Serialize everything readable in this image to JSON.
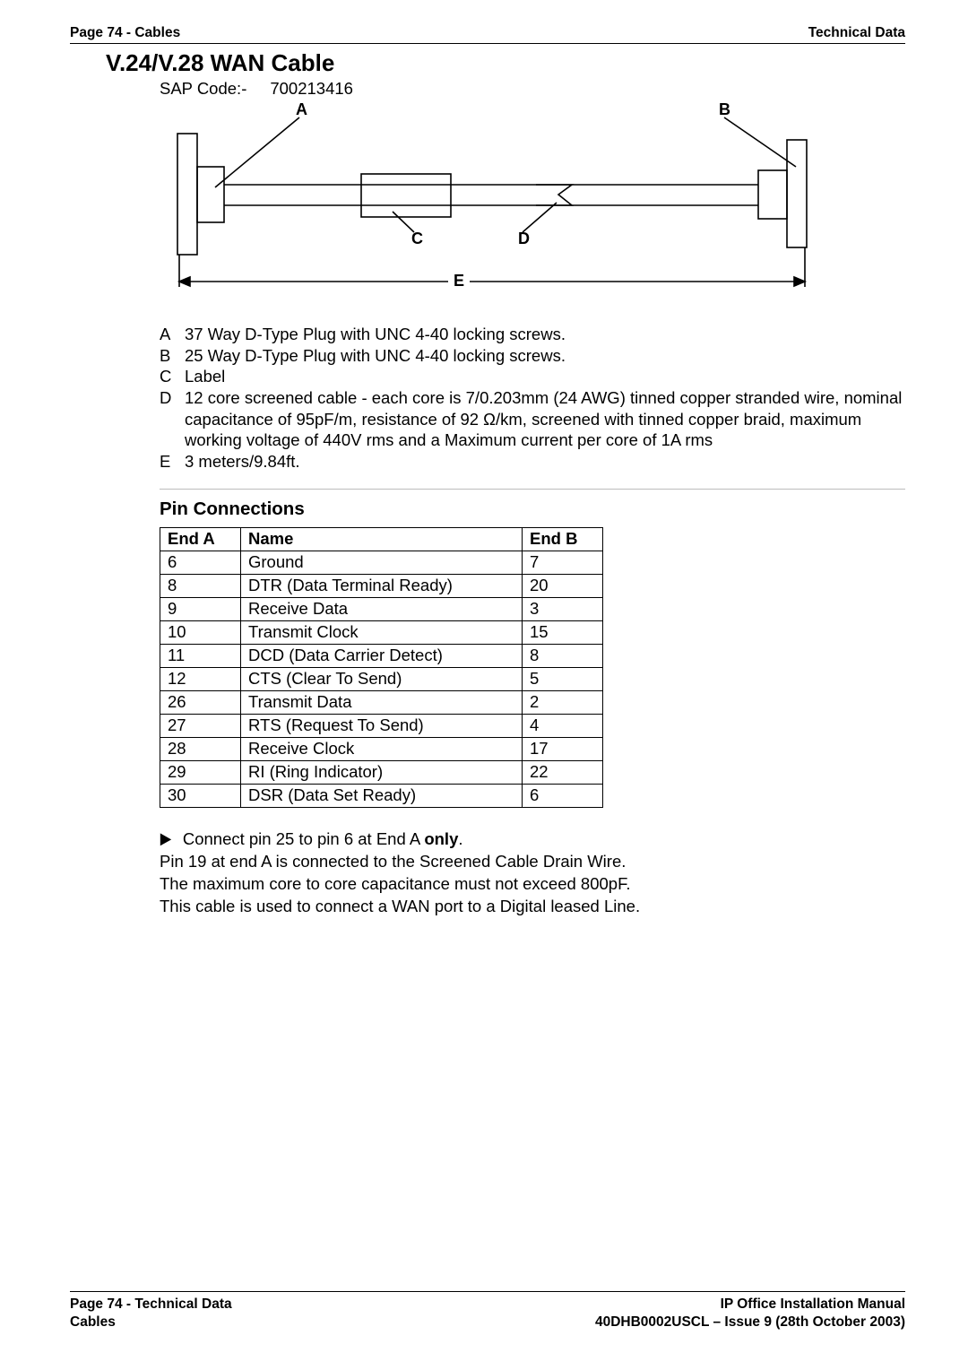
{
  "header": {
    "left": "Page 74 - Cables",
    "right": "Technical Data"
  },
  "title": "V.24/V.28 WAN Cable",
  "sap_label": "SAP Code:-",
  "sap_code": "700213416",
  "diagram": {
    "A": "A",
    "B": "B",
    "C": "C",
    "D": "D",
    "E": "E"
  },
  "definitions": [
    {
      "key": "A",
      "val": "37 Way D-Type Plug with UNC 4-40 locking screws."
    },
    {
      "key": "B",
      "val": "25 Way D-Type Plug with UNC 4-40 locking screws."
    },
    {
      "key": "C",
      "val": "Label"
    },
    {
      "key": "D",
      "val": "12 core screened cable - each core is 7/0.203mm (24 AWG) tinned copper stranded wire, nominal capacitance of 95pF/m, resistance of 92 Ω/km, screened with tinned copper braid, maximum working voltage of 440V rms and a Maximum current per core of 1A rms"
    },
    {
      "key": "E",
      "val": "3 meters/9.84ft."
    }
  ],
  "pin_heading": "Pin Connections",
  "pin_headers": {
    "a": "End A",
    "name": "Name",
    "b": "End B"
  },
  "pin_rows": [
    {
      "a": "6",
      "name": "Ground",
      "b": "7"
    },
    {
      "a": "8",
      "name": "DTR (Data Terminal Ready)",
      "b": "20"
    },
    {
      "a": "9",
      "name": "Receive Data",
      "b": "3"
    },
    {
      "a": "10",
      "name": "Transmit Clock",
      "b": "15"
    },
    {
      "a": "11",
      "name": "DCD (Data Carrier Detect)",
      "b": "8"
    },
    {
      "a": "12",
      "name": "CTS (Clear To Send)",
      "b": "5"
    },
    {
      "a": "26",
      "name": "Transmit Data",
      "b": "2"
    },
    {
      "a": "27",
      "name": "RTS (Request To Send)",
      "b": "4"
    },
    {
      "a": "28",
      "name": "Receive Clock",
      "b": "17"
    },
    {
      "a": "29",
      "name": "RI (Ring Indicator)",
      "b": "22"
    },
    {
      "a": "30",
      "name": "DSR (Data Set Ready)",
      "b": "6"
    }
  ],
  "notes": {
    "bullet_prefix": "Connect pin 25 to pin 6 at End A ",
    "bullet_bold": "only",
    "bullet_suffix": ".",
    "line2": "Pin 19 at end A is connected to the Screened Cable Drain Wire.",
    "line3": "The maximum core to core capacitance must not exceed 800pF.",
    "line4": "This cable is used to connect a WAN port to a Digital leased Line."
  },
  "footer": {
    "left1": "Page 74 - Technical Data",
    "left2": "Cables",
    "right1": "IP Office Installation Manual",
    "right2": "40DHB0002USCL – Issue 9 (28th October 2003)"
  }
}
